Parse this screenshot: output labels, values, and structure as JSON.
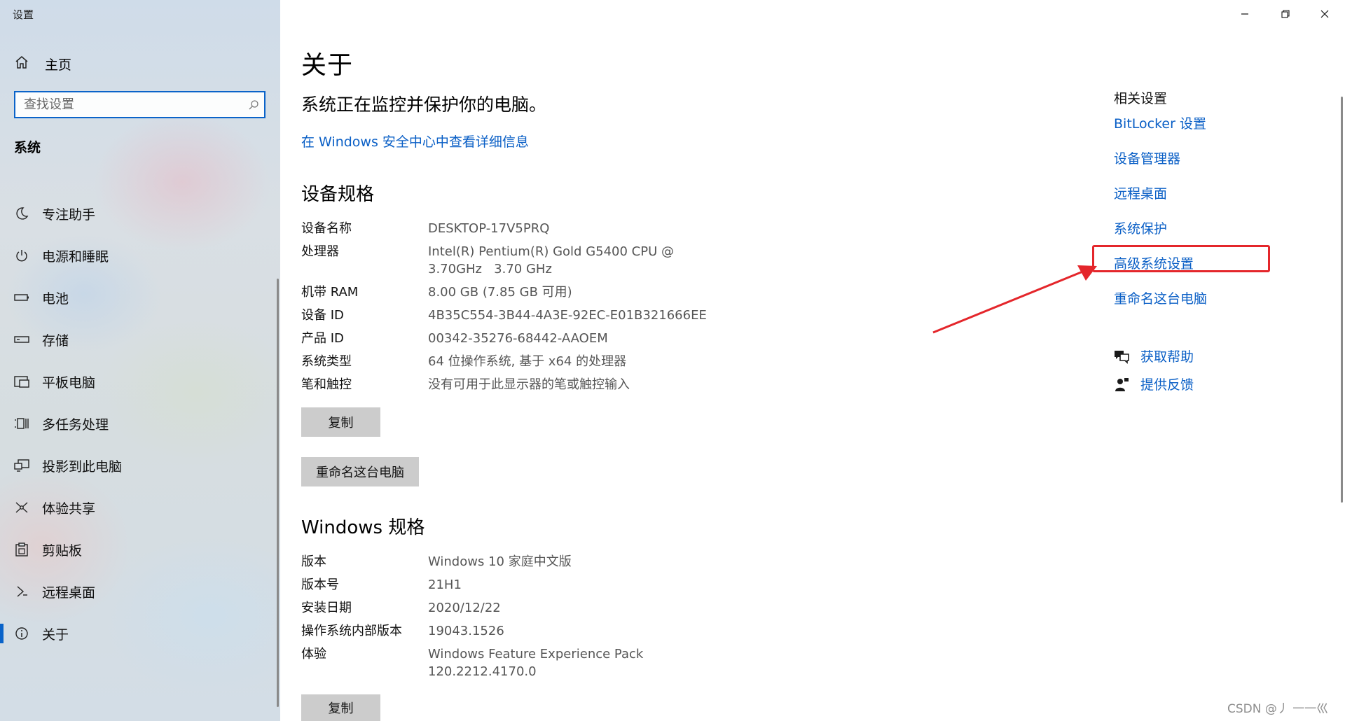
{
  "window": {
    "title": "设置",
    "controls": {
      "minimize": "minimize",
      "restore": "restore",
      "close": "close"
    }
  },
  "sidebar": {
    "home_label": "主页",
    "search_placeholder": "查找设置",
    "section_title": "系统",
    "items": [
      {
        "label": "专注助手",
        "icon": "moon-icon"
      },
      {
        "label": "电源和睡眠",
        "icon": "power-icon"
      },
      {
        "label": "电池",
        "icon": "battery-icon"
      },
      {
        "label": "存储",
        "icon": "storage-icon"
      },
      {
        "label": "平板电脑",
        "icon": "tablet-icon"
      },
      {
        "label": "多任务处理",
        "icon": "multitask-icon"
      },
      {
        "label": "投影到此电脑",
        "icon": "project-icon"
      },
      {
        "label": "体验共享",
        "icon": "share-icon"
      },
      {
        "label": "剪贴板",
        "icon": "clipboard-icon"
      },
      {
        "label": "远程桌面",
        "icon": "remote-icon"
      },
      {
        "label": "关于",
        "icon": "info-icon",
        "active": true
      }
    ]
  },
  "main": {
    "title": "关于",
    "protection_status": "系统正在监控并保护你的电脑。",
    "security_link": "在 Windows 安全中心中查看详细信息",
    "device_specs": {
      "heading": "设备规格",
      "rows": [
        {
          "key": "设备名称",
          "value": "DESKTOP-17V5PRQ"
        },
        {
          "key": "处理器",
          "value": "Intel(R) Pentium(R) Gold G5400 CPU @",
          "value2": "3.70GHz   3.70 GHz"
        },
        {
          "key": "机带 RAM",
          "value": "8.00 GB (7.85 GB 可用)"
        },
        {
          "key": "设备 ID",
          "value": "4B35C554-3B44-4A3E-92EC-E01B321666EE"
        },
        {
          "key": "产品 ID",
          "value": "00342-35276-68442-AAOEM"
        },
        {
          "key": "系统类型",
          "value": "64 位操作系统, 基于 x64 的处理器"
        },
        {
          "key": "笔和触控",
          "value": "没有可用于此显示器的笔或触控输入"
        }
      ],
      "copy_button": "复制",
      "rename_button": "重命名这台电脑"
    },
    "windows_specs": {
      "heading": "Windows 规格",
      "rows": [
        {
          "key": "版本",
          "value": "Windows 10 家庭中文版"
        },
        {
          "key": "版本号",
          "value": "21H1"
        },
        {
          "key": "安装日期",
          "value": "2020/12/22"
        },
        {
          "key": "操作系统内部版本",
          "value": "19043.1526"
        },
        {
          "key": "体验",
          "value": "Windows Feature Experience Pack",
          "value2": "120.2212.4170.0"
        }
      ],
      "copy_button": "复制"
    }
  },
  "related": {
    "title": "相关设置",
    "links": [
      "BitLocker 设置",
      "设备管理器",
      "远程桌面",
      "系统保护",
      "高级系统设置",
      "重命名这台电脑"
    ],
    "highlighted": "高级系统设置",
    "help": "获取帮助",
    "feedback": "提供反馈"
  },
  "watermark": "CSDN @丿 一一巛",
  "colors": {
    "accent": "#0a63c9",
    "link": "#0a5fc6",
    "annotation": "#e4262b",
    "button": "#cccccc"
  }
}
